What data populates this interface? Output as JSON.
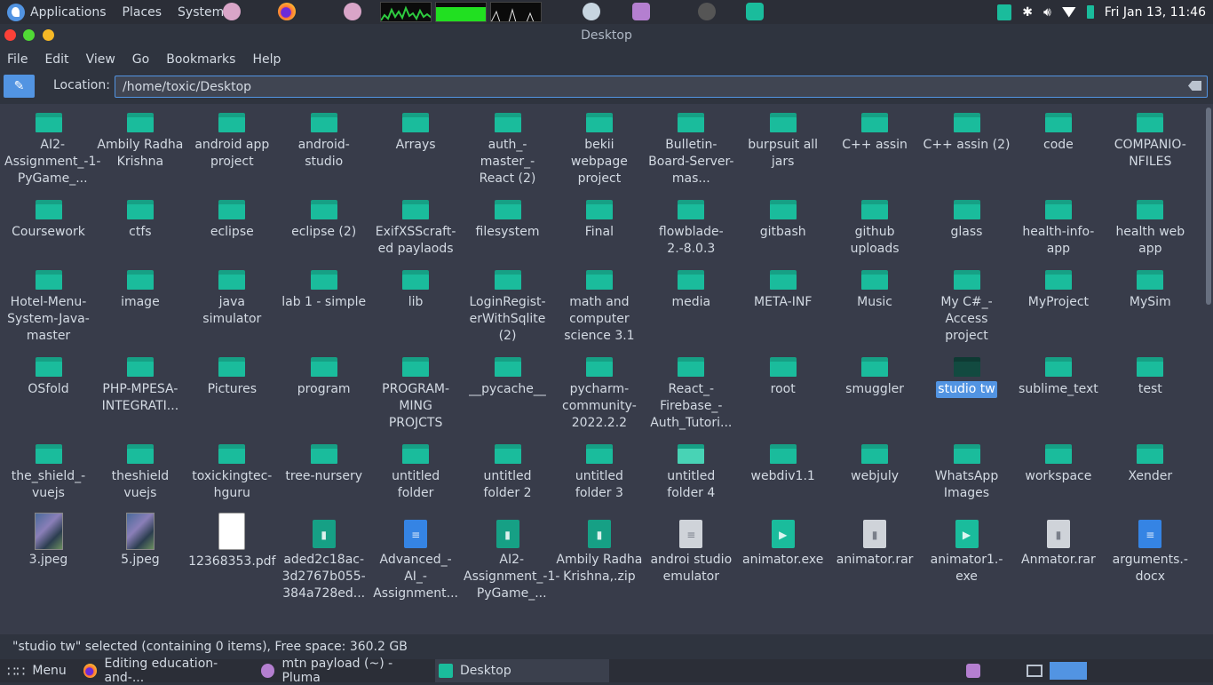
{
  "top_panel": {
    "menus": [
      "Applications",
      "Places",
      "System"
    ],
    "clock": "Fri Jan 13, 11:46"
  },
  "window": {
    "title": "Desktop"
  },
  "menubar": [
    "File",
    "Edit",
    "View",
    "Go",
    "Bookmarks",
    "Help"
  ],
  "location": {
    "label": "Location:",
    "value": "/home/toxic/Desktop"
  },
  "items": [
    {
      "name": "AI2-Assignment_-1-PyGame_...",
      "type": "folder"
    },
    {
      "name": "Ambily Radha Krishna",
      "type": "folder"
    },
    {
      "name": "android app project",
      "type": "folder"
    },
    {
      "name": "android-studio",
      "type": "folder"
    },
    {
      "name": "Arrays",
      "type": "folder"
    },
    {
      "name": "auth_-master_-React (2)",
      "type": "folder"
    },
    {
      "name": "bekii webpage project",
      "type": "folder"
    },
    {
      "name": "Bulletin-Board-Server-mas...",
      "type": "folder"
    },
    {
      "name": "burpsuit all jars",
      "type": "folder"
    },
    {
      "name": "C++ assin",
      "type": "folder"
    },
    {
      "name": "C++ assin (2)",
      "type": "folder"
    },
    {
      "name": "code",
      "type": "folder"
    },
    {
      "name": "COMPANIO-NFILES",
      "type": "folder"
    },
    {
      "name": "Coursework",
      "type": "folder"
    },
    {
      "name": "ctfs",
      "type": "folder"
    },
    {
      "name": "eclipse",
      "type": "folder"
    },
    {
      "name": "eclipse (2)",
      "type": "folder"
    },
    {
      "name": "ExifXSScraft-ed paylaods",
      "type": "folder"
    },
    {
      "name": "filesystem",
      "type": "folder"
    },
    {
      "name": "Final",
      "type": "folder"
    },
    {
      "name": "flowblade-2.-8.0.3",
      "type": "folder"
    },
    {
      "name": "gitbash",
      "type": "folder"
    },
    {
      "name": "github uploads",
      "type": "folder"
    },
    {
      "name": "glass",
      "type": "folder"
    },
    {
      "name": "health-info-app",
      "type": "folder"
    },
    {
      "name": "health web app",
      "type": "folder"
    },
    {
      "name": "Hotel-Menu-System-Java-master",
      "type": "folder"
    },
    {
      "name": "image",
      "type": "folder"
    },
    {
      "name": "java simulator",
      "type": "folder"
    },
    {
      "name": "lab 1 - simple",
      "type": "folder"
    },
    {
      "name": "lib",
      "type": "folder"
    },
    {
      "name": "LoginRegist-erWithSqlite (2)",
      "type": "folder"
    },
    {
      "name": "math and computer science 3.1",
      "type": "folder"
    },
    {
      "name": "media",
      "type": "folder"
    },
    {
      "name": "META-INF",
      "type": "folder"
    },
    {
      "name": "Music",
      "type": "folder"
    },
    {
      "name": "My C#_-Access project",
      "type": "folder"
    },
    {
      "name": "MyProject",
      "type": "folder"
    },
    {
      "name": "MySim",
      "type": "folder"
    },
    {
      "name": "OSfold",
      "type": "folder"
    },
    {
      "name": "PHP-MPESA-INTEGRATI...",
      "type": "folder"
    },
    {
      "name": "Pictures",
      "type": "folder"
    },
    {
      "name": "program",
      "type": "folder"
    },
    {
      "name": "PROGRAM-MING PROJCTS",
      "type": "folder"
    },
    {
      "name": "__pycache__",
      "type": "folder"
    },
    {
      "name": "pycharm-community-2022.2.2",
      "type": "folder"
    },
    {
      "name": "React_-Firebase_-Auth_Tutori...",
      "type": "folder"
    },
    {
      "name": "root",
      "type": "folder"
    },
    {
      "name": "smuggler",
      "type": "folder"
    },
    {
      "name": "studio tw",
      "type": "folder-dark",
      "selected": true
    },
    {
      "name": "sublime_text",
      "type": "folder"
    },
    {
      "name": "test",
      "type": "folder"
    },
    {
      "name": "the_shield_-vuejs",
      "type": "folder"
    },
    {
      "name": "theshield vuejs",
      "type": "folder"
    },
    {
      "name": "toxickingtec-hguru",
      "type": "folder"
    },
    {
      "name": "tree-nursery",
      "type": "folder"
    },
    {
      "name": "untitled folder",
      "type": "folder"
    },
    {
      "name": "untitled folder 2",
      "type": "folder"
    },
    {
      "name": "untitled folder 3",
      "type": "folder"
    },
    {
      "name": "untitled folder 4",
      "type": "folder-hover"
    },
    {
      "name": "webdiv1.1",
      "type": "folder"
    },
    {
      "name": "webjuly",
      "type": "folder"
    },
    {
      "name": "WhatsApp Images",
      "type": "folder"
    },
    {
      "name": "workspace",
      "type": "folder"
    },
    {
      "name": "Xender",
      "type": "folder"
    },
    {
      "name": "3.jpeg",
      "type": "image"
    },
    {
      "name": "5.jpeg",
      "type": "image"
    },
    {
      "name": "12368353.pdf",
      "type": "pdf"
    },
    {
      "name": "aded2c18ac-3d2767b055-384a728ed...",
      "type": "archive"
    },
    {
      "name": "Advanced_-AI_-Assignment...",
      "type": "docx"
    },
    {
      "name": "AI2-Assignment_-1-PyGame_...",
      "type": "archive"
    },
    {
      "name": "Ambily Radha Krishna,.zip",
      "type": "archive"
    },
    {
      "name": "androi studio emulator",
      "type": "text"
    },
    {
      "name": "animator.exe",
      "type": "exe"
    },
    {
      "name": "animator.rar",
      "type": "rar"
    },
    {
      "name": "animator1.-exe",
      "type": "exe"
    },
    {
      "name": "Anmator.rar",
      "type": "rar"
    },
    {
      "name": "arguments.-docx",
      "type": "docx"
    }
  ],
  "status": "\"studio tw\" selected (containing 0 items), Free space: 360.2 GB",
  "taskbar": {
    "menu_label": "Menu",
    "tasks": [
      "Editing education-and-...",
      "mtn payload (~) - Pluma",
      "Desktop"
    ]
  },
  "colors": {
    "accent": "#5294e2",
    "folder": "#1abc9c",
    "bg": "#383c4a"
  }
}
